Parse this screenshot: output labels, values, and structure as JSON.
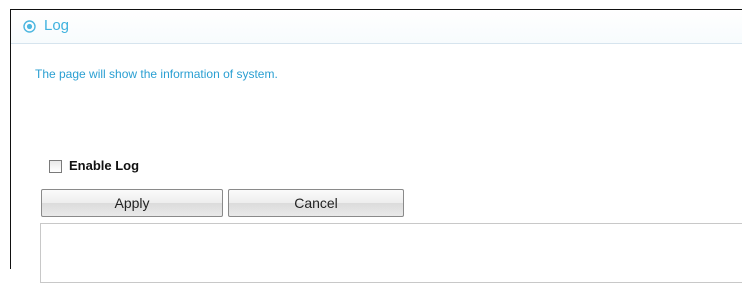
{
  "header": {
    "title": "Log",
    "icon": "radio-target-icon",
    "accent_color": "#3fb2de"
  },
  "main": {
    "description": "The page will show the information of system.",
    "enable_log": {
      "label": "Enable Log",
      "checked": false
    },
    "buttons": {
      "apply_label": "Apply",
      "cancel_label": "Cancel"
    },
    "log_content": ""
  }
}
